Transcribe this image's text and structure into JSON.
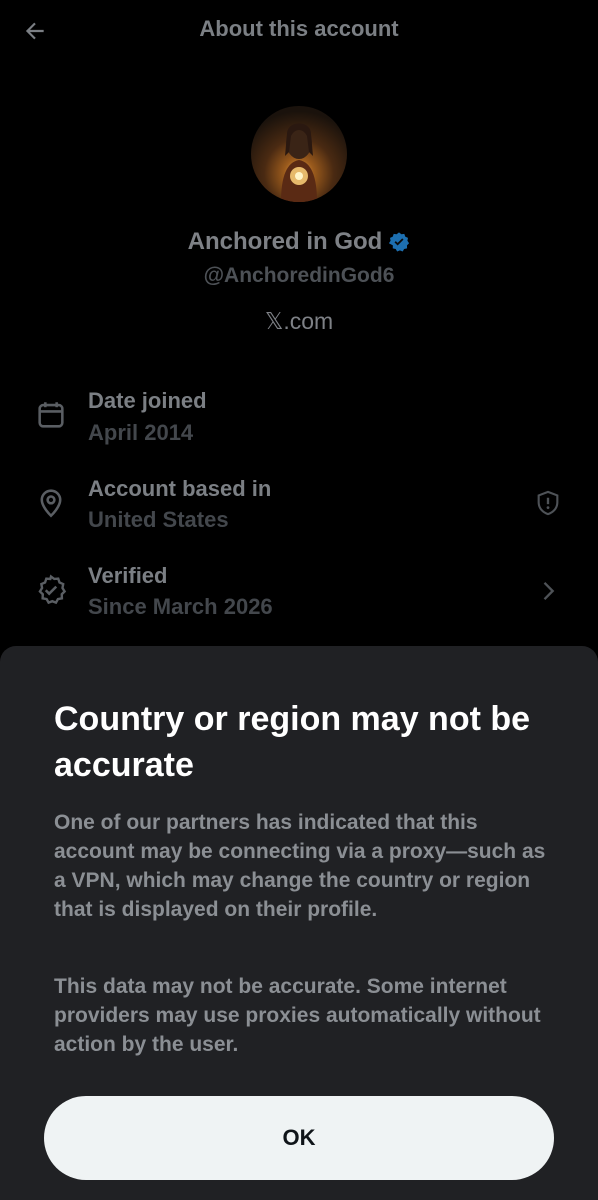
{
  "header": {
    "title": "About this account",
    "back_icon": "arrow-left-icon"
  },
  "profile": {
    "name": "Anchored in God",
    "handle": "@AnchoredinGod6",
    "source": "𝕏.com",
    "verified_color": "#1d9bf0"
  },
  "details": [
    {
      "icon": "calendar-icon",
      "label": "Date joined",
      "value": "April 2014"
    },
    {
      "icon": "location-pin-icon",
      "label": "Account based in",
      "value": "United States",
      "action_icon": "shield-alert-icon"
    },
    {
      "icon": "verified-check-icon",
      "label": "Verified",
      "value": "Since March 2026",
      "action_icon": "chevron-right-icon"
    }
  ],
  "sheet": {
    "title": "Country or region may not be accurate",
    "paragraph1": "One of our partners has indicated that this account may be connecting via a proxy—such as a VPN, which may change the country or region that is displayed on their profile.",
    "paragraph2": "This data may not be accurate. Some internet providers may use proxies automatically without action by the user.",
    "ok_label": "OK"
  },
  "colors": {
    "sheet_background": "#202124",
    "button_background": "#eff3f4",
    "page_background": "#000000"
  }
}
